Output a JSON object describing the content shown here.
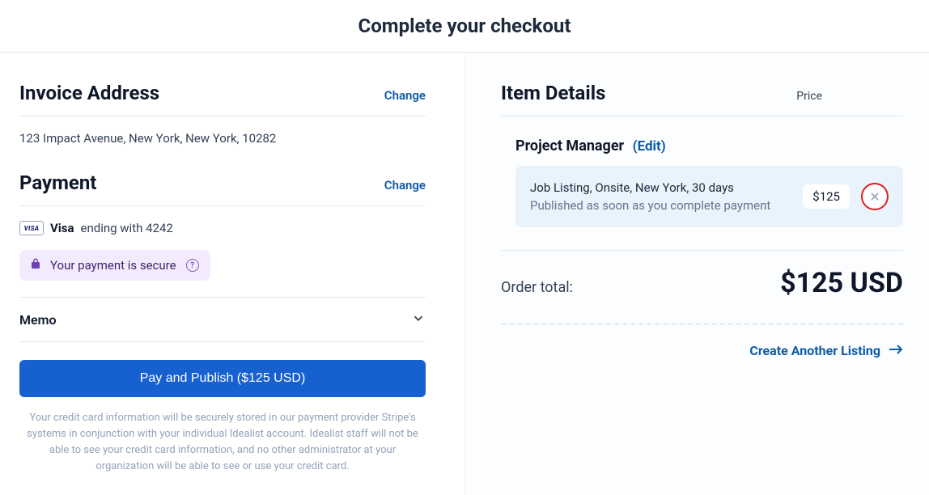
{
  "header": {
    "title": "Complete your checkout"
  },
  "invoice": {
    "heading": "Invoice Address",
    "change_label": "Change",
    "address": "123 Impact Avenue, New York, New York, 10282"
  },
  "payment": {
    "heading": "Payment",
    "change_label": "Change",
    "card_brand": "Visa",
    "card_ending": "ending with 4242",
    "secure_text": "Your payment is secure"
  },
  "memo": {
    "label": "Memo"
  },
  "actions": {
    "pay_label": "Pay and Publish ($125 USD)",
    "disclaimer": "Your credit card information will be securely stored in our payment provider Stripe's systems in conjunction with your individual Idealist account. Idealist staff will not be able to see your credit card information, and no other administrator at your organization will be able to see or use your credit card."
  },
  "details": {
    "heading": "Item Details",
    "price_col": "Price",
    "item_name": "Project Manager",
    "edit_label": "(Edit)",
    "listing_line1": "Job Listing, Onsite, New York, 30 days",
    "listing_line2": "Published as soon as you complete payment",
    "listing_price": "$125",
    "order_total_label": "Order total:",
    "order_total_value": "$125 USD",
    "create_another": "Create Another Listing"
  }
}
